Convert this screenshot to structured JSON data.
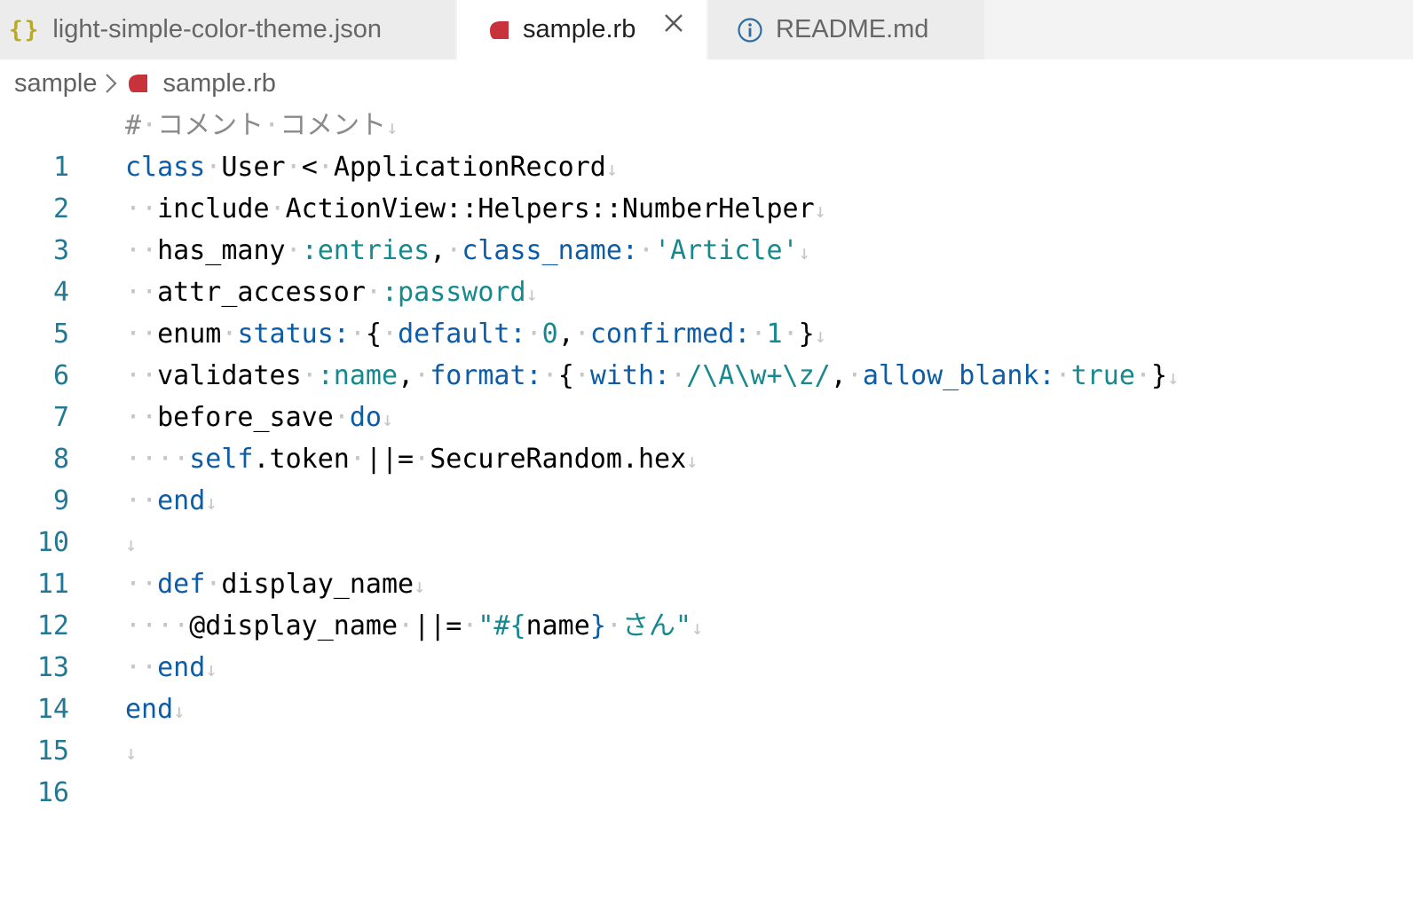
{
  "tabs": [
    {
      "label": "light-simple-color-theme.json",
      "icon": "json-braces-icon",
      "icon_text": "{}"
    },
    {
      "label": "sample.rb",
      "icon": "ruby-file-icon",
      "active": true
    },
    {
      "label": "README.md",
      "icon": "info-icon"
    }
  ],
  "breadcrumb": {
    "folder": "sample",
    "file": "sample.rb"
  },
  "colors": {
    "keyword": "#0d5ca6",
    "symbol": "#16898f",
    "comment": "#8a8a8a",
    "line_number": "#237893",
    "ruby_icon": "#c8323a"
  },
  "editor": {
    "line_numbers": [
      "1",
      "2",
      "3",
      "4",
      "5",
      "6",
      "7",
      "8",
      "9",
      "10",
      "11",
      "12",
      "13",
      "14",
      "15",
      "16"
    ],
    "whitespace_dot": "·",
    "eol_marker": "↓",
    "tokens": {
      "l1": [
        "#",
        "コメント",
        "コメント"
      ],
      "l2": [
        "class",
        "User",
        "<",
        "ApplicationRecord"
      ],
      "l3": [
        "include",
        "ActionView::Helpers::NumberHelper"
      ],
      "l4": [
        "has_many",
        ":entries",
        ",",
        "class_name:",
        "'Article'"
      ],
      "l5": [
        "attr_accessor",
        ":password"
      ],
      "l6": [
        "enum",
        "status:",
        "{",
        "default:",
        "0",
        ",",
        "confirmed:",
        "1",
        "}"
      ],
      "l7": [
        "validates",
        ":name",
        ",",
        "format:",
        "{",
        "with:",
        "/\\A\\w+\\z/",
        ",",
        "allow_blank:",
        "true",
        "}"
      ],
      "l8": [
        "before_save",
        "do"
      ],
      "l9": [
        "self",
        ".token",
        "||=",
        "SecureRandom.hex"
      ],
      "l10": [
        "end"
      ],
      "l12": [
        "def",
        "display_name"
      ],
      "l13": [
        "@display_name",
        "||=",
        "\"#{",
        "name",
        "}",
        "さん\""
      ],
      "l14": [
        "end"
      ],
      "l15": [
        "end"
      ]
    }
  }
}
